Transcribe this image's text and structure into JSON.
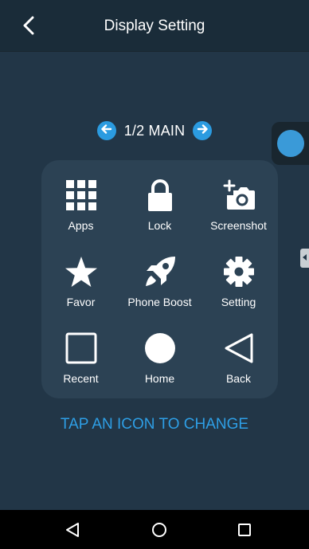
{
  "header": {
    "title": "Display Setting",
    "back_icon": "chevron-left-icon"
  },
  "page_switcher": {
    "label": "1/2 MAIN",
    "prev_icon": "arrow-left-icon",
    "next_icon": "arrow-right-icon",
    "accent_color": "#2b9be0"
  },
  "grid": {
    "items": [
      {
        "label": "Apps",
        "icon": "apps-grid-icon"
      },
      {
        "label": "Lock",
        "icon": "lock-icon"
      },
      {
        "label": "Screenshot",
        "icon": "screenshot-camera-icon"
      },
      {
        "label": "Favor",
        "icon": "star-icon"
      },
      {
        "label": "Phone Boost",
        "icon": "rocket-icon"
      },
      {
        "label": "Setting",
        "icon": "gear-icon"
      },
      {
        "label": "Recent",
        "icon": "square-icon"
      },
      {
        "label": "Home",
        "icon": "circle-icon"
      },
      {
        "label": "Back",
        "icon": "triangle-back-icon"
      }
    ]
  },
  "hint": {
    "text": "TAP AN ICON TO CHANGE",
    "color": "#2e9fe6"
  },
  "system_nav": {
    "back_icon": "nav-back-icon",
    "home_icon": "nav-home-icon",
    "recents_icon": "nav-recents-icon"
  },
  "colors": {
    "background": "#223647",
    "panel": "#2c4254",
    "floating_ball": "#3a9ad8"
  }
}
